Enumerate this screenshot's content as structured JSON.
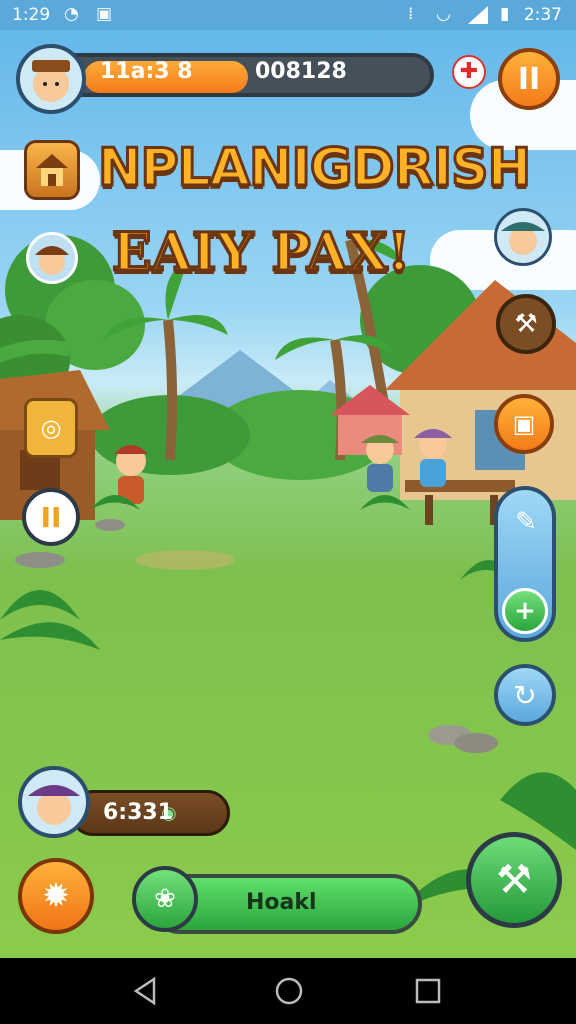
{
  "status_bar": {
    "time": "1:29",
    "clock": "2:37"
  },
  "hud": {
    "left_value": "11a:3 8",
    "right_value": "008128"
  },
  "title": {
    "line1": "NPLANIGDRISH",
    "line2": "EAIY PAX!"
  },
  "coins": {
    "value": "6:331"
  },
  "action": {
    "label": "Hoakl"
  },
  "colors": {
    "accent_orange": "#f38b1c",
    "bar_green": "#36b24a",
    "title_gold": "#ffb226",
    "sky_blue": "#5aa9da"
  },
  "icons": [
    "pause-icon",
    "medkit-icon",
    "house-icon",
    "hammer-icon",
    "chest-icon",
    "tool-icon",
    "plus-icon",
    "refresh-icon",
    "sun-icon",
    "shovel-icon",
    "coin-icon",
    "sprout-icon"
  ]
}
